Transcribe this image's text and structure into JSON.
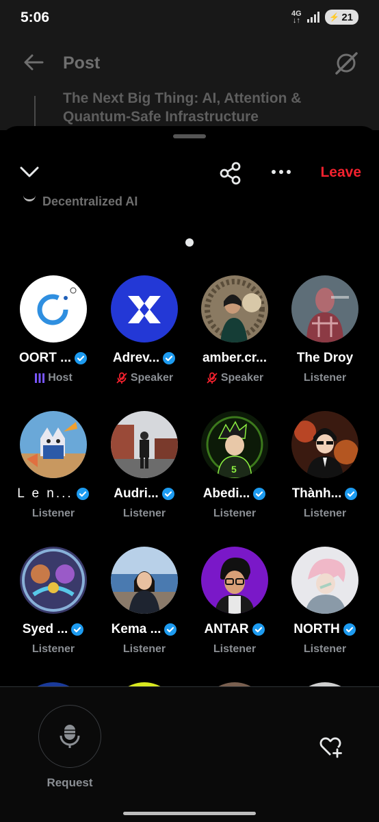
{
  "status": {
    "time": "5:06",
    "network": "4G",
    "battery": "21"
  },
  "background": {
    "title": "Post",
    "post_text": "The Next Big Thing: AI, Attention & Quantum-Safe Infrastructure"
  },
  "header": {
    "leave_label": "Leave"
  },
  "space": {
    "title": "Decentralized AI"
  },
  "participants": [
    {
      "name": "OORT ...",
      "role": "Host",
      "verified": true
    },
    {
      "name": "Adrev...",
      "role": "Speaker",
      "verified": true
    },
    {
      "name": "amber.cr...",
      "role": "Speaker",
      "verified": false
    },
    {
      "name": "The Droy",
      "role": "Listener",
      "verified": false
    },
    {
      "name": "L e n...",
      "role": "Listener",
      "verified": true
    },
    {
      "name": "Audri...",
      "role": "Listener",
      "verified": true
    },
    {
      "name": "Abedi...",
      "role": "Listener",
      "verified": true
    },
    {
      "name": "Thành...",
      "role": "Listener",
      "verified": true
    },
    {
      "name": "Syed ...",
      "role": "Listener",
      "verified": true
    },
    {
      "name": "Kema ...",
      "role": "Listener",
      "verified": true
    },
    {
      "name": "ANTAR",
      "role": "Listener",
      "verified": true
    },
    {
      "name": "NORTH",
      "role": "Listener",
      "verified": true
    }
  ],
  "footer": {
    "request_label": "Request"
  },
  "colors": {
    "leave": "#f4212e",
    "host": "#7856ff",
    "verified": "#1d9bf0",
    "muted": "#f4212e"
  }
}
